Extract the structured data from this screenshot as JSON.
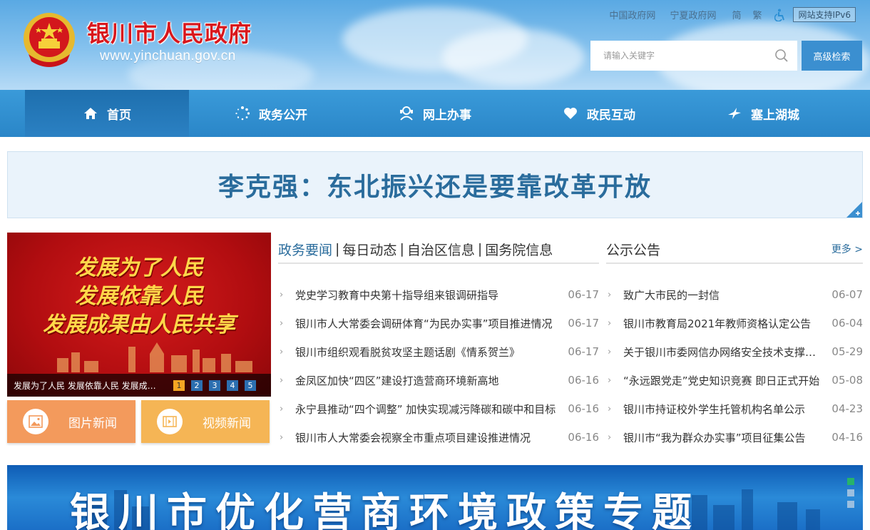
{
  "header": {
    "site_title": "银川市人民政府",
    "site_url": "www.yinchuan.gov.cn",
    "top_links": [
      "中国政府网",
      "宁夏政府网"
    ],
    "lang_simplified": "简",
    "lang_traditional": "繁",
    "ipv6_badge": "网站支持IPv6",
    "search_placeholder": "请输入关键字",
    "advanced_search": "高级检索"
  },
  "nav": {
    "items": [
      {
        "label": "首页",
        "icon": "home-icon"
      },
      {
        "label": "政务公开",
        "icon": "dots-circle-icon"
      },
      {
        "label": "网上办事",
        "icon": "person-service-icon"
      },
      {
        "label": "政民互动",
        "icon": "heart-hands-icon"
      },
      {
        "label": "塞上湖城",
        "icon": "bird-icon"
      }
    ]
  },
  "headline": "李克强：东北振兴还是要靠改革开放",
  "slideshow": {
    "slogans": [
      "发展为了人民",
      "发展依靠人民",
      "发展成果由人民共享"
    ],
    "caption": "发展为了人民 发展依靠人民 发展成果由人民共享",
    "pages": [
      "1",
      "2",
      "3",
      "4",
      "5"
    ],
    "active_page": 1
  },
  "media_buttons": {
    "picture_news": "图片新闻",
    "video_news": "视频新闻"
  },
  "news": {
    "tabs": [
      "政务要闻",
      "每日动态",
      "自治区信息",
      "国务院信息"
    ],
    "items": [
      {
        "title": "党史学习教育中央第十指导组来银调研指导",
        "date": "06-17"
      },
      {
        "title": "银川市人大常委会调研体育“为民办实事”项目推进情况",
        "date": "06-17"
      },
      {
        "title": "银川市组织观看脱贫攻坚主题话剧《情系贺兰》",
        "date": "06-17"
      },
      {
        "title": "金凤区加快“四区”建设打造营商环境新高地",
        "date": "06-16"
      },
      {
        "title": "永宁县推动“四个调整” 加快实现减污降碳和碳中和目标",
        "date": "06-16"
      },
      {
        "title": "银川市人大常委会视察全市重点项目建设推进情况",
        "date": "06-16"
      }
    ]
  },
  "notices": {
    "title": "公示公告",
    "more": "更多 >",
    "items": [
      {
        "title": "致广大市民的一封信",
        "date": "06-07"
      },
      {
        "title": "银川市教育局2021年教师资格认定公告",
        "date": "06-04"
      },
      {
        "title": "关于银川市委网信办网络安全技术支撑服务项目公告",
        "date": "05-29"
      },
      {
        "title": "“永远跟党走”党史知识竞赛 即日正式开始",
        "date": "05-08"
      },
      {
        "title": "银川市持证校外学生托管机构名单公示",
        "date": "04-23"
      },
      {
        "title": "银川市“我为群众办实事”项目征集公告",
        "date": "04-16"
      }
    ]
  },
  "bottom_banner": {
    "text": "银川市优化营商环境政策专题"
  },
  "colors": {
    "primary_blue": "#2a86c8",
    "title_red": "#d8171d",
    "headline_blue": "#2a6c9c",
    "orange": "#f39a5c",
    "amber": "#f5b555"
  }
}
